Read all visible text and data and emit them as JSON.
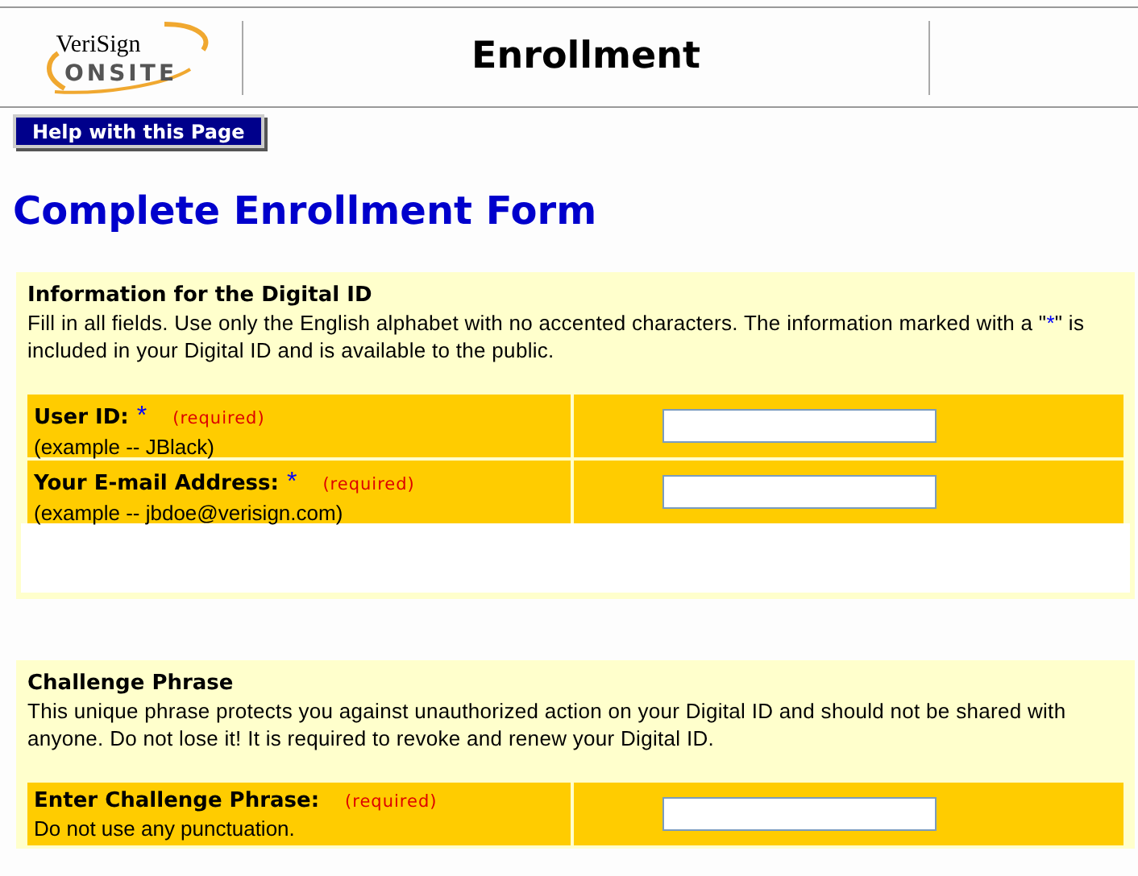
{
  "header": {
    "logo": {
      "brand": "VeriSign",
      "product": "ONSITE"
    },
    "title": "Enrollment"
  },
  "help_button": "Help with this Page",
  "page_title": "Complete Enrollment Form",
  "sections": [
    {
      "heading": "Information for the Digital ID",
      "description": [
        {
          "text": "Fill in all fields. Use only the English alphabet with no accented characters. The information marked with a \""
        },
        {
          "text": "*",
          "kind": "marker"
        },
        {
          "text": "\" is included in your Digital ID and is available to the public."
        }
      ],
      "blank_area": true,
      "fields": [
        {
          "label": "User ID:",
          "marker": "*",
          "required_note": "(required)",
          "hint": "(example -- JBlack)"
        },
        {
          "label": "Your E-mail Address:",
          "marker": "*",
          "required_note": "(required)",
          "hint": "(example -- jbdoe@verisign.com)"
        }
      ]
    },
    {
      "heading": "Challenge Phrase",
      "description": [
        {
          "text": "This unique phrase protects you against unauthorized action on your Digital ID and should not be shared with anyone. Do not lose it! It is required to revoke and renew your Digital ID."
        }
      ],
      "blank_area": false,
      "fields": [
        {
          "label": "Enter Challenge Phrase:",
          "required_note": "(required)",
          "hint": "Do not use any punctuation."
        }
      ]
    }
  ]
}
